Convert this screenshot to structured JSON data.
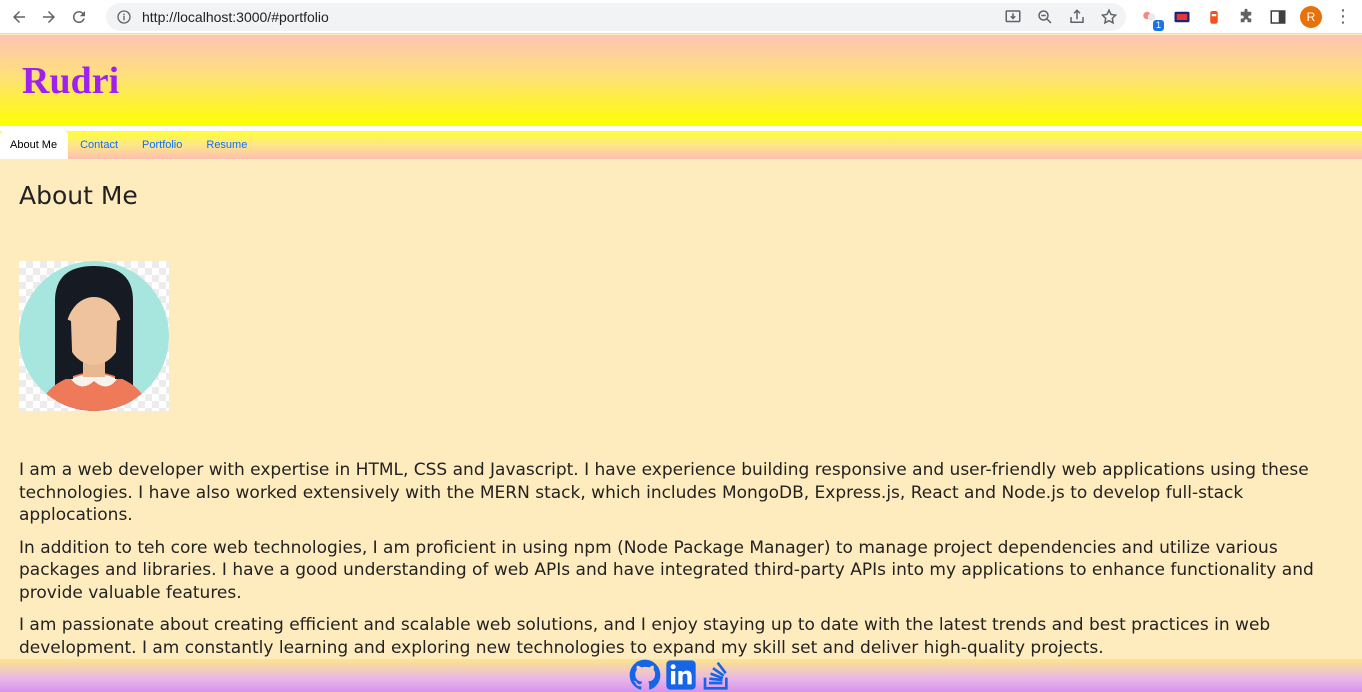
{
  "browser": {
    "url": "http://localhost:3000/#portfolio",
    "extension_badge": "1",
    "profile_initial": "R",
    "icons": [
      "back-icon",
      "forward-icon",
      "reload-icon",
      "info-icon",
      "install-icon",
      "zoom-icon",
      "share-icon",
      "bookmark-star-icon",
      "extension-icon",
      "puzzle-icon",
      "side-panel-icon",
      "kebab-menu-icon"
    ]
  },
  "header": {
    "title": "Rudri",
    "title_color": "#a020f0"
  },
  "tabs": [
    {
      "label": "About Me",
      "active": true
    },
    {
      "label": "Contact",
      "active": false
    },
    {
      "label": "Portfolio",
      "active": false
    },
    {
      "label": "Resume",
      "active": false
    }
  ],
  "main": {
    "heading": "About Me",
    "paragraphs": [
      "I am a web developer with expertise in HTML, CSS and Javascript. I have experience building responsive and user-friendly web applications using these technologies. I have also worked extensively with the MERN stack, which includes MongoDB, Express.js, React and Node.js to develop full-stack applocations.",
      "In addition to teh core web technologies, I am proficient in using npm (Node Package Manager) to manage project dependencies and utilize various packages and libraries. I have a good understanding of web APIs and have integrated third-party APIs into my applications to enhance functionality and provide valuable features.",
      "I am passionate about creating efficient and scalable web solutions, and I enjoy staying up to date with the latest trends and best practices in web development. I am constantly learning and exploring new technologies to expand my skill set and deliver high-quality projects."
    ]
  },
  "footer": {
    "links": [
      "github-icon",
      "linkedin-icon",
      "stackoverflow-icon"
    ],
    "icon_color": "#1565e6"
  },
  "colors": {
    "page_background": "#ffecbe",
    "tab_link": "#0d6efd"
  }
}
